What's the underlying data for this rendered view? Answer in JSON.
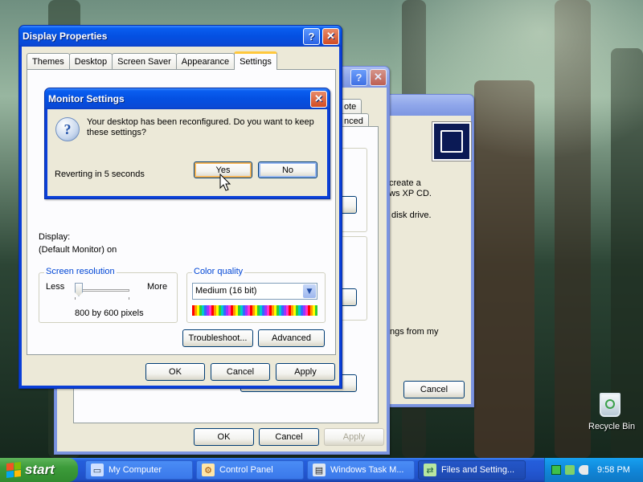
{
  "desktop": {
    "recycle_bin_label": "Recycle Bin"
  },
  "back_window": {
    "partial_text_1": "create a",
    "partial_text_2": "ws XP CD.",
    "partial_text_3": "disk drive.",
    "cancel": "Cancel"
  },
  "mid_window": {
    "tab_partial_1": "ote",
    "tab_partial_2": "nced",
    "partial_text": "ngs from my",
    "ok": "OK",
    "cancel": "Cancel",
    "apply": "Apply"
  },
  "display_properties": {
    "title": "Display Properties",
    "tabs": [
      "Themes",
      "Desktop",
      "Screen Saver",
      "Appearance",
      "Settings"
    ],
    "active_tab": "Settings",
    "display_label": "Display:",
    "display_value": "(Default Monitor) on",
    "screen_resolution": {
      "label": "Screen resolution",
      "less": "Less",
      "more": "More",
      "value": "800 by 600 pixels",
      "slider_position": 0
    },
    "color_quality": {
      "label": "Color quality",
      "selected": "Medium (16 bit)"
    },
    "troubleshoot": "Troubleshoot...",
    "advanced": "Advanced",
    "ok": "OK",
    "cancel": "Cancel",
    "apply": "Apply"
  },
  "monitor_settings": {
    "title": "Monitor Settings",
    "message": "Your desktop has been reconfigured.  Do you want to keep these settings?",
    "countdown": "Reverting in 5 seconds",
    "yes": "Yes",
    "no": "No"
  },
  "taskbar": {
    "start": "start",
    "tasks": [
      {
        "label": "My Computer"
      },
      {
        "label": "Control Panel"
      },
      {
        "label": "Windows Task M..."
      },
      {
        "label": "Files and Setting..."
      }
    ],
    "clock": "9:58 PM"
  },
  "colors": {
    "title_active": "#0a5ef0",
    "dialog_bg": "#ece9d8",
    "group_label": "#0046d5",
    "start_green": "#3c9b3a"
  }
}
